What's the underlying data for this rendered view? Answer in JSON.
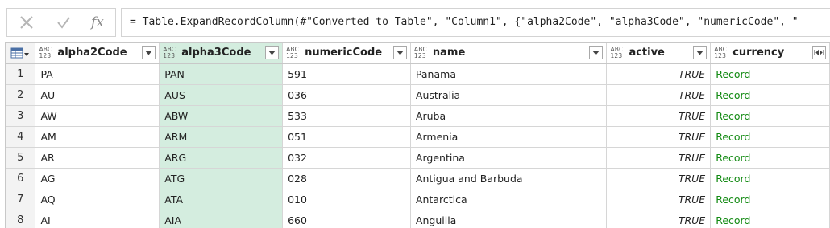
{
  "formula_bar": {
    "cancel_icon": "close-icon",
    "confirm_icon": "checkmark-icon",
    "fx_label": "fx",
    "formula": "= Table.ExpandRecordColumn(#\"Converted to Table\", \"Column1\", {\"alpha2Code\", \"alpha3Code\", \"numericCode\", \""
  },
  "grid": {
    "type_badge_top": "ABC",
    "type_badge_bottom": "123",
    "columns": [
      {
        "label": "alpha2Code"
      },
      {
        "label": "alpha3Code",
        "selected": true
      },
      {
        "label": "numericCode"
      },
      {
        "label": "name"
      },
      {
        "label": "active"
      },
      {
        "label": "currency",
        "expand": true
      }
    ],
    "rows": [
      {
        "n": "1",
        "alpha2Code": "PA",
        "alpha3Code": "PAN",
        "numericCode": "591",
        "name": "Panama",
        "active": "TRUE",
        "currency": "Record"
      },
      {
        "n": "2",
        "alpha2Code": "AU",
        "alpha3Code": "AUS",
        "numericCode": "036",
        "name": "Australia",
        "active": "TRUE",
        "currency": "Record"
      },
      {
        "n": "3",
        "alpha2Code": "AW",
        "alpha3Code": "ABW",
        "numericCode": "533",
        "name": "Aruba",
        "active": "TRUE",
        "currency": "Record"
      },
      {
        "n": "4",
        "alpha2Code": "AM",
        "alpha3Code": "ARM",
        "numericCode": "051",
        "name": "Armenia",
        "active": "TRUE",
        "currency": "Record"
      },
      {
        "n": "5",
        "alpha2Code": "AR",
        "alpha3Code": "ARG",
        "numericCode": "032",
        "name": "Argentina",
        "active": "TRUE",
        "currency": "Record"
      },
      {
        "n": "6",
        "alpha2Code": "AG",
        "alpha3Code": "ATG",
        "numericCode": "028",
        "name": "Antigua and Barbuda",
        "active": "TRUE",
        "currency": "Record"
      },
      {
        "n": "7",
        "alpha2Code": "AQ",
        "alpha3Code": "ATA",
        "numericCode": "010",
        "name": "Antarctica",
        "active": "TRUE",
        "currency": "Record"
      },
      {
        "n": "8",
        "alpha2Code": "AI",
        "alpha3Code": "AIA",
        "numericCode": "660",
        "name": "Anguilla",
        "active": "TRUE",
        "currency": "Record"
      }
    ]
  },
  "colors": {
    "selected_column": "#d4eddf",
    "record_link": "#128a12"
  }
}
